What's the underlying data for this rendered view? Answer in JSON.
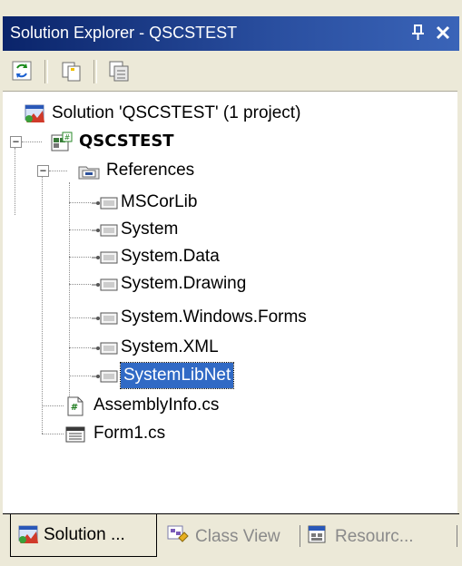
{
  "window": {
    "title": "Solution Explorer - QSCSTEST",
    "pin_glyph": "Ԅ",
    "close_glyph": "✕"
  },
  "toolbar": {
    "buttons": [
      {
        "icon": "refresh-icon"
      },
      {
        "icon": "show-files-icon"
      },
      {
        "icon": "properties-icon"
      }
    ]
  },
  "tree": {
    "solution": "Solution 'QSCSTEST' (1 project)",
    "project": "QSCSTEST",
    "references_label": "References",
    "references": [
      "MSCorLib",
      "System",
      "System.Data",
      "System.Drawing",
      "System.Windows.Forms",
      "System.XML",
      "SystemLibNet"
    ],
    "selected": "SystemLibNet",
    "files": [
      "AssemblyInfo.cs",
      "Form1.cs"
    ],
    "collapse_glyph": "−"
  },
  "tabs": [
    {
      "label": "Solution ...",
      "icon": "solution-icon",
      "active": true
    },
    {
      "label": "Class View",
      "icon": "class-view-icon",
      "active": false
    },
    {
      "label": "Resourc...",
      "icon": "resource-view-icon",
      "active": false
    }
  ],
  "colors": {
    "title_bg": "#0a246a",
    "selection": "#316ac5",
    "panel_bg": "#ece9d8"
  }
}
